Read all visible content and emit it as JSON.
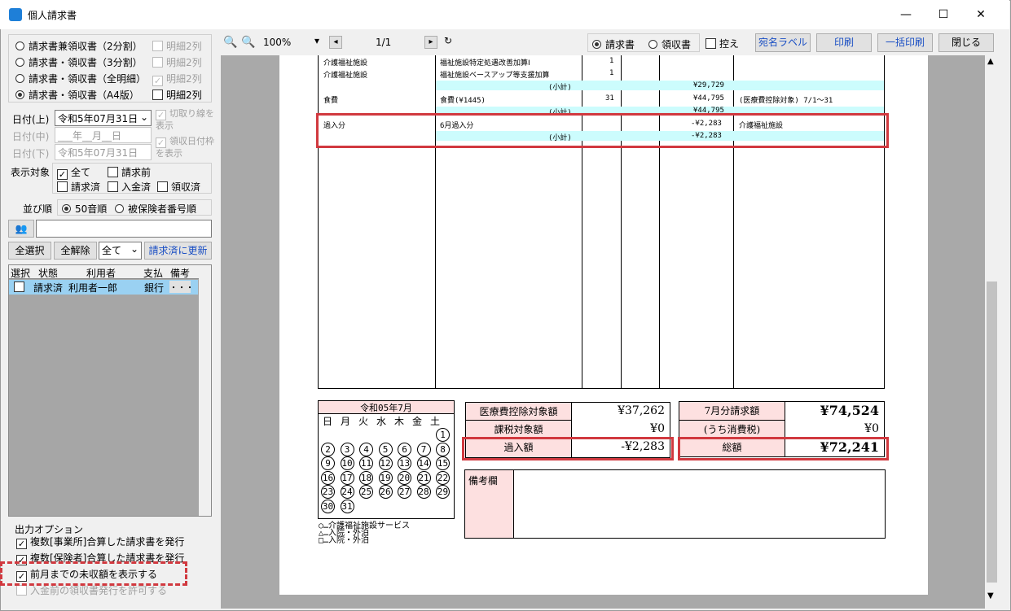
{
  "window": {
    "title": "個人請求書",
    "minimize": "—",
    "maximize": "☐",
    "close": "✕"
  },
  "print_type": {
    "options": [
      "請求書兼領収書（2分割）",
      "請求書・領収書（3分割）",
      "請求書・領収書（全明細）",
      "請求書・領収書（A4版）"
    ],
    "selected": 3,
    "detail2": "明細2列"
  },
  "dates": {
    "upper_label": "日付(上)",
    "upper_value": "令和5年07月31日",
    "middle_label": "日付(中)",
    "middle_value": "___年__月__日",
    "lower_label": "日付(下)",
    "lower_value": "令和5年07月31日",
    "cut_line": "切取り線を表示",
    "receipt_frame": "領収日付枠を表示"
  },
  "display": {
    "label": "表示対象",
    "all": "全て",
    "before": "請求前",
    "billed": "請求済",
    "paid": "入金済",
    "received": "領収済"
  },
  "sort": {
    "label": "並び順",
    "opt1": "50音順",
    "opt2": "被保険者番号順"
  },
  "actions": {
    "select_all": "全選択",
    "deselect_all": "全解除",
    "filter": "全て",
    "update": "請求済に更新"
  },
  "list": {
    "headers": [
      "選択",
      "状態",
      "利用者",
      "支払",
      "備考"
    ],
    "rows": [
      {
        "status": "請求済",
        "user": "利用者一郎",
        "pay": "銀行",
        "note": "・・・"
      }
    ]
  },
  "output": {
    "title": "出力オプション",
    "opt1": "複数[事業所]合算した請求書を発行",
    "opt2": "複数[保険者]合算した請求書を発行",
    "opt3": "前月までの未収額を表示する",
    "opt4": "入金前の領収書発行を許可する"
  },
  "toolbar": {
    "zoom": "100%",
    "page": "1/1",
    "invoice": "請求書",
    "receipt": "領収書",
    "copy": "控え",
    "label_btn": "宛名ラベル",
    "print": "印刷",
    "batch_print": "一括印刷",
    "close": "閉じる"
  },
  "doc": {
    "rows": [
      {
        "a": "介護福祉施設",
        "b": "福祉施設特定処遇改善加算Ⅰ",
        "c": "1",
        "d": "",
        "e": "",
        "f": ""
      },
      {
        "a": "介護福祉施設",
        "b": "福祉施設ベースアップ等支援加算",
        "c": "1",
        "d": "",
        "e": "",
        "f": ""
      },
      {
        "a": "",
        "b": "(小計)",
        "c": "",
        "d": "",
        "e": "¥29,729",
        "f": ""
      },
      {
        "a": "食費",
        "b": "食費(¥1445)",
        "c": "31",
        "d": "",
        "e": "¥44,795",
        "f": "(医療費控除対象) 7/1～31"
      },
      {
        "a": "",
        "b": "(小計)",
        "c": "",
        "d": "",
        "e": "¥44,795",
        "f": ""
      },
      {
        "a": "過入分",
        "b": "6月過入分",
        "c": "",
        "d": "",
        "e": "-¥2,283",
        "f": "介護福祉施設"
      },
      {
        "a": "",
        "b": "(小計)",
        "c": "",
        "d": "",
        "e": "-¥2,283",
        "f": ""
      }
    ],
    "calendar": {
      "title": "令和05年7月",
      "days": [
        "日",
        "月",
        "火",
        "水",
        "木",
        "金",
        "土"
      ],
      "legend1": "○…介護福祉施設サービス",
      "legend2": "△…入院・外泊",
      "legend3": "□…入院・外泊"
    },
    "summary": {
      "medical_label": "医療費控除対象額",
      "medical": "¥37,262",
      "tax_label": "課税対象額",
      "tax": "¥0",
      "over_label": "過入額",
      "over": "-¥2,283",
      "month_label": "7月分請求額",
      "month": "¥74,524",
      "consumption_label": "(うち消費税)",
      "consumption": "¥0",
      "total_label": "総額",
      "total": "¥72,241"
    },
    "memo_label": "備考欄"
  }
}
